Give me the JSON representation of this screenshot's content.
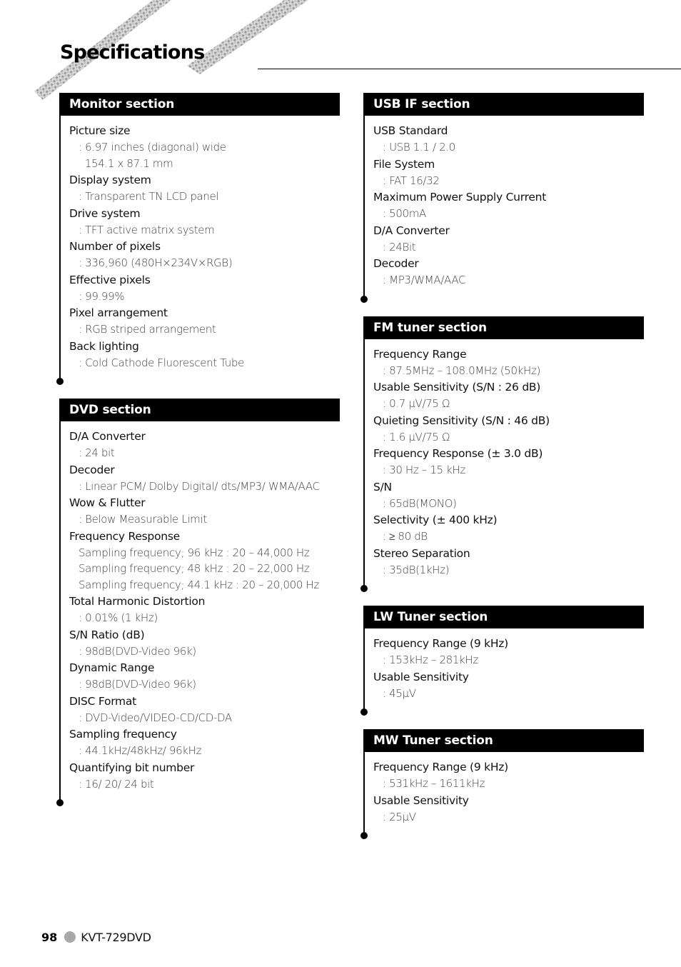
{
  "page": {
    "title": "Specifications",
    "footer": {
      "page_number": "98",
      "model": "KVT-729DVD"
    }
  },
  "left_column": [
    {
      "header": "Monitor section",
      "specs": [
        {
          "label": "Picture size",
          "values": [
            ": 6.97 inches (diagonal) wide",
            "  154.1 x 87.1 mm"
          ]
        },
        {
          "label": "Display system",
          "values": [
            ": Transparent TN LCD panel"
          ]
        },
        {
          "label": "Drive system",
          "values": [
            ": TFT active matrix system"
          ]
        },
        {
          "label": "Number of pixels",
          "values": [
            ": 336,960 (480H×234V×RGB)"
          ]
        },
        {
          "label": "Effective pixels",
          "values": [
            ": 99.99%"
          ]
        },
        {
          "label": "Pixel arrangement",
          "values": [
            ": RGB striped arrangement"
          ]
        },
        {
          "label": "Back lighting",
          "values": [
            ": Cold Cathode Fluorescent Tube"
          ]
        }
      ]
    },
    {
      "header": "DVD section",
      "specs": [
        {
          "label": "D/A Converter",
          "values": [
            ": 24 bit"
          ]
        },
        {
          "label": "Decoder",
          "values": [
            ": Linear PCM/ Dolby Digital/ dts/MP3/ WMA/AAC"
          ]
        },
        {
          "label": "Wow & Flutter",
          "values": [
            ": Below Measurable Limit"
          ]
        },
        {
          "label": "Frequency Response",
          "values": [
            "Sampling frequency; 96 kHz : 20 – 44,000 Hz",
            "Sampling frequency; 48 kHz : 20 – 22,000 Hz",
            "Sampling frequency; 44.1 kHz : 20 – 20,000 Hz"
          ]
        },
        {
          "label": "Total Harmonic Distortion",
          "values": [
            ": 0.01% (1 kHz)"
          ]
        },
        {
          "label": "S/N Ratio (dB)",
          "values": [
            ": 98dB(DVD-Video 96k)"
          ]
        },
        {
          "label": "Dynamic Range",
          "values": [
            ": 98dB(DVD-Video 96k)"
          ]
        },
        {
          "label": "DISC Format",
          "values": [
            ": DVD-Video/VIDEO-CD/CD-DA"
          ]
        },
        {
          "label": "Sampling frequency",
          "values": [
            ": 44.1kHz/48kHz/ 96kHz"
          ]
        },
        {
          "label": "Quantifying bit number",
          "values": [
            ": 16/ 20/ 24 bit"
          ]
        }
      ]
    }
  ],
  "right_column": [
    {
      "header": "USB IF section",
      "specs": [
        {
          "label": "USB Standard",
          "values": [
            ": USB 1.1 / 2.0"
          ]
        },
        {
          "label": "File System",
          "values": [
            ": FAT 16/32"
          ]
        },
        {
          "label": "Maximum Power Supply Current",
          "values": [
            ": 500mA"
          ]
        },
        {
          "label": "D/A Converter",
          "values": [
            ": 24Bit"
          ]
        },
        {
          "label": "Decoder",
          "values": [
            ": MP3/WMA/AAC"
          ]
        }
      ]
    },
    {
      "header": "FM tuner section",
      "specs": [
        {
          "label": "Frequency Range",
          "values": [
            ": 87.5MHz – 108.0MHz (50kHz)"
          ]
        },
        {
          "label": "Usable Sensitivity (S/N : 26 dB)",
          "values": [
            ": 0.7 μV/75 Ω"
          ]
        },
        {
          "label": "Quieting Sensitivity (S/N : 46 dB)",
          "values": [
            ": 1.6 μV/75 Ω"
          ]
        },
        {
          "label": "Frequency Response (± 3.0 dB)",
          "values": [
            ": 30 Hz – 15 kHz"
          ]
        },
        {
          "label": "S/N",
          "values": [
            ": 65dB(MONO)"
          ]
        },
        {
          "label": "Selectivity (± 400 kHz)",
          "values": [
            ": ≥ 80 dB"
          ]
        },
        {
          "label": "Stereo Separation",
          "values": [
            ": 35dB(1kHz)"
          ]
        }
      ]
    },
    {
      "header": "LW Tuner section",
      "specs": [
        {
          "label": "Frequency Range (9 kHz)",
          "values": [
            ": 153kHz – 281kHz"
          ]
        },
        {
          "label": "Usable Sensitivity",
          "values": [
            ": 45μV"
          ]
        }
      ]
    },
    {
      "header": "MW Tuner section",
      "specs": [
        {
          "label": "Frequency Range (9 kHz)",
          "values": [
            ": 531kHz – 1611kHz"
          ]
        },
        {
          "label": "Usable Sensitivity",
          "values": [
            ": 25μV"
          ]
        }
      ]
    }
  ]
}
